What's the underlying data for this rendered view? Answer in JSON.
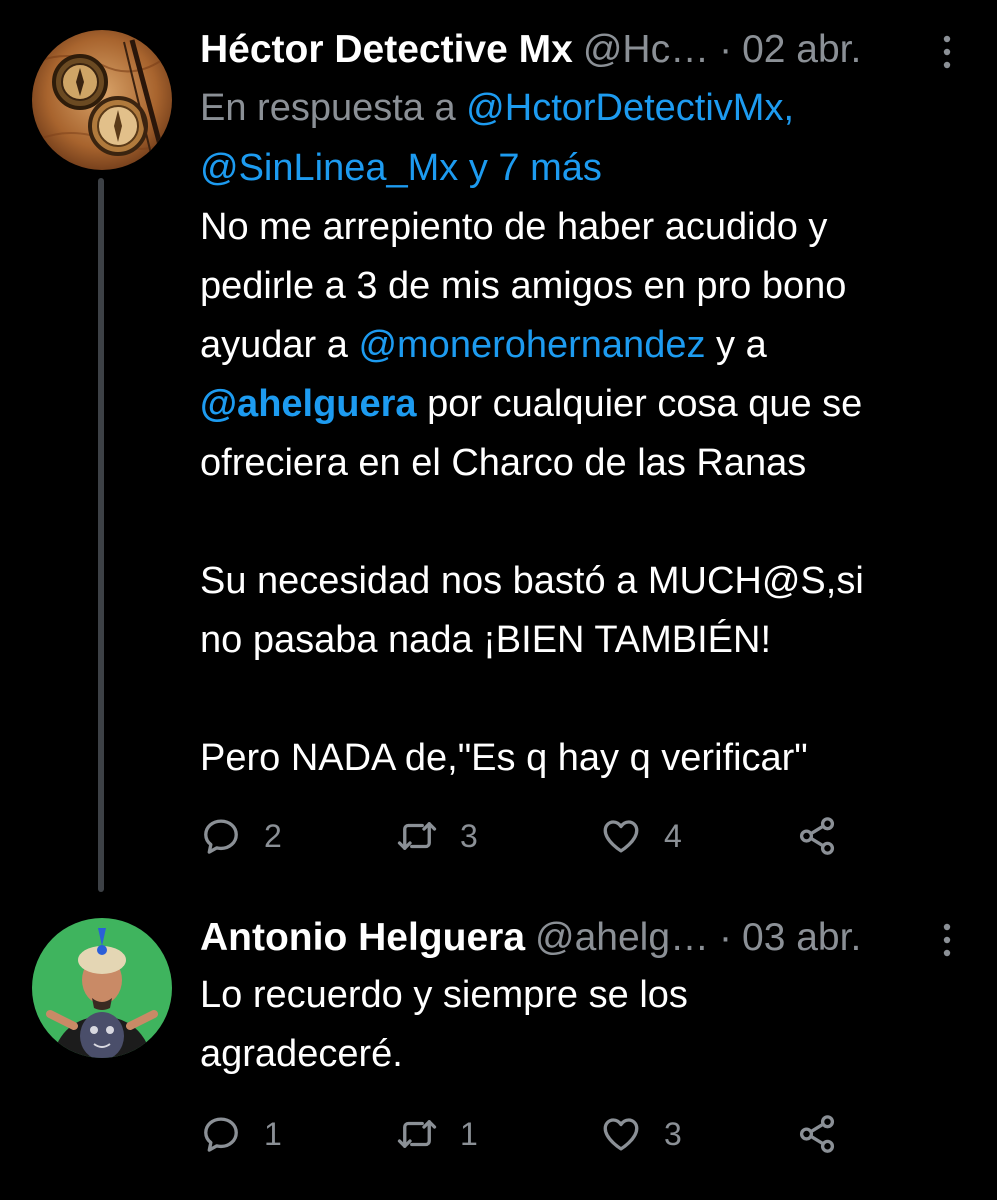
{
  "tweets": [
    {
      "author": {
        "name": "Héctor Detective Mx",
        "handle": "@Hc…",
        "avatar_icon": "antique-compass-avatar"
      },
      "separator": "·",
      "date": "02 abr.",
      "reply_to": {
        "prefix": "En respuesta a",
        "first_mention": "@HctorDetectivMx,",
        "second_line": "@SinLinea_Mx y 7 más"
      },
      "body": {
        "para1": {
          "line1": "No me arrepiento de haber acudido y",
          "line2": "pedirle a 3 de mis amigos en pro bono",
          "line3_pre": "ayudar a",
          "mention1": "@monerohernandez",
          "line3_post": "y a",
          "mention2": "@ahelguera",
          "line4_post": "por cualquier cosa que se",
          "line5": "ofreciera en el Charco de las Ranas"
        },
        "para2": {
          "line1": "Su necesidad nos bastó a MUCH@S,si",
          "line2": "no pasaba nada ¡BIEN TAMBIÉN!"
        },
        "para3": "Pero NADA de,\"Es q hay q verificar\""
      },
      "stats": {
        "replies": "2",
        "retweets": "3",
        "likes": "4"
      }
    },
    {
      "author": {
        "name": "Antonio Helguera",
        "handle": "@ahelg…",
        "avatar_icon": "man-with-turban-holding-mask-avatar"
      },
      "separator": "·",
      "date": "03 abr.",
      "body": {
        "line1": "Lo recuerdo y siempre se los",
        "line2": "agradeceré."
      },
      "stats": {
        "replies": "1",
        "retweets": "1",
        "likes": "3"
      }
    }
  ],
  "icons": {
    "more": "more-vertical-icon",
    "reply": "reply-icon",
    "retweet": "retweet-icon",
    "like": "heart-icon",
    "share": "share-icon"
  },
  "colors": {
    "background": "#000000",
    "text": "#ffffff",
    "secondary": "#8b9096",
    "link": "#1d9bf0",
    "thread_line": "#3d4146"
  }
}
